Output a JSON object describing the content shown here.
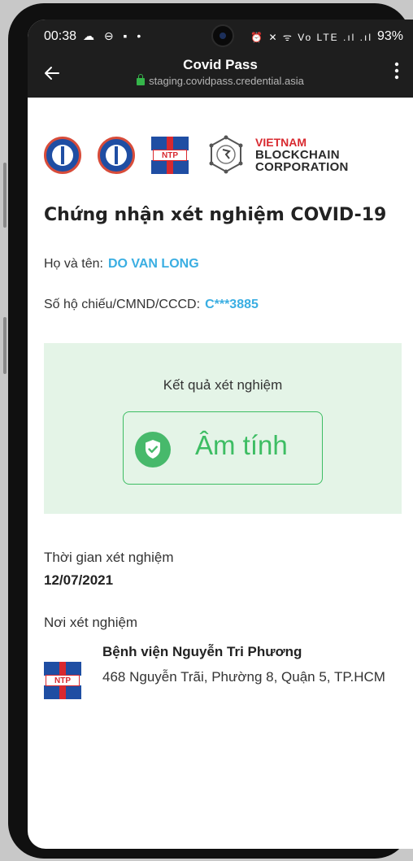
{
  "status_bar": {
    "time": "00:38",
    "left_icons": "☁ ⊖ ▪ •",
    "right_icons": "⏰ ✕ ᯤ Vo LTE .ıl .ıl",
    "battery": "93%"
  },
  "app_bar": {
    "back_icon": "arrow-left-icon",
    "title": "Covid Pass",
    "url": "staging.covidpass.credential.asia",
    "menu_icon": "more-vertical-icon"
  },
  "logos": {
    "vbc_line1": "VIETNAM",
    "vbc_line2": "BLOCKCHAIN",
    "vbc_line3": "CORPORATION",
    "ntp_text": "NTP"
  },
  "certificate": {
    "title": "Chứng nhận xét nghiệm COVID-19",
    "name_label": "Họ và tên:",
    "name_value": "DO VAN LONG",
    "id_label": "Số hộ chiếu/CMND/CCCD:",
    "id_value": "C***3885"
  },
  "result": {
    "label": "Kết quả xét nghiệm",
    "value": "Âm tính",
    "icon": "shield-check-icon"
  },
  "test_time": {
    "label": "Thời gian xét nghiệm",
    "value": "12/07/2021"
  },
  "test_place": {
    "label": "Nơi xét nghiệm",
    "hospital_name": "Bệnh viện Nguyễn Tri Phương",
    "hospital_address": "468 Nguyễn Trãi, Phường 8, Quận 5, TP.HCM"
  },
  "colors": {
    "accent_blue": "#3aaee2",
    "result_green": "#3dbd63",
    "result_bg": "#e4f4e7",
    "topbar_bg": "#1e1e1e"
  }
}
